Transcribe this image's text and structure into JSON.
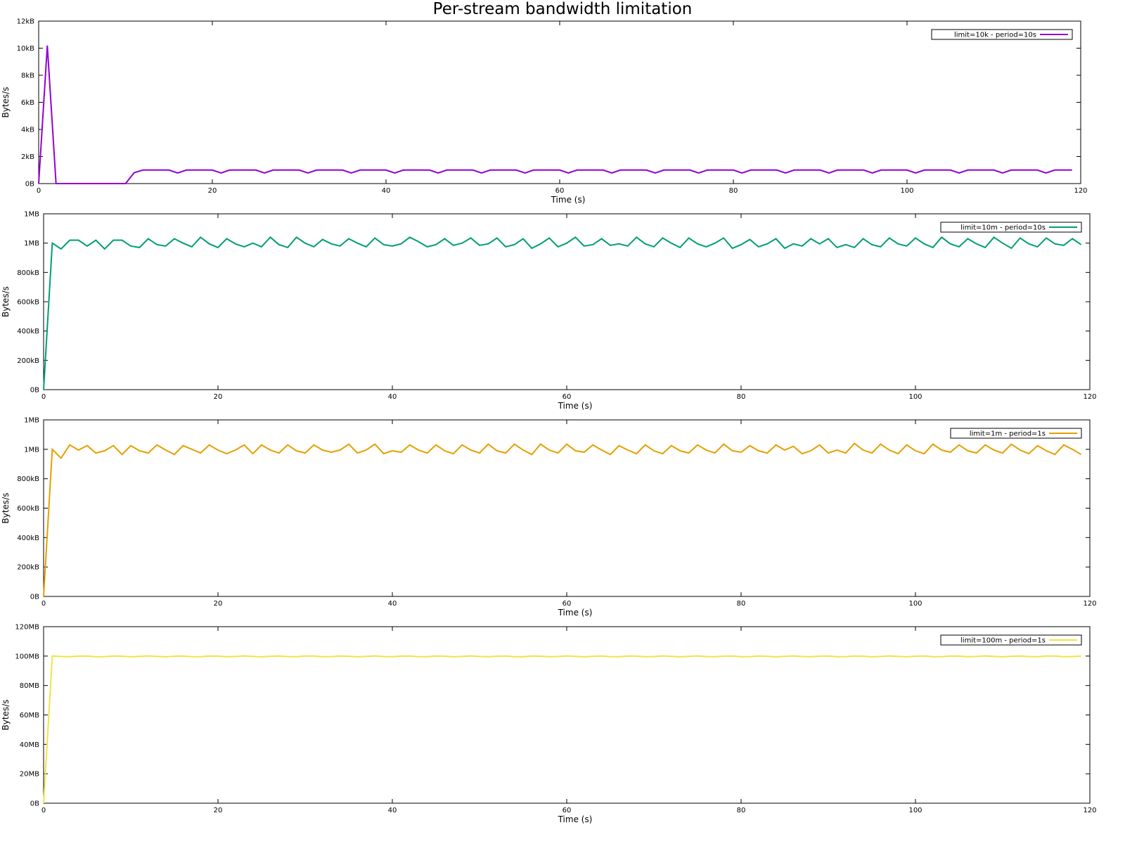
{
  "figure": {
    "title": "Per-stream bandwidth limitation"
  },
  "chart_data": [
    {
      "type": "line",
      "title": "",
      "xlabel": "Time (s)",
      "ylabel": "Bytes/s",
      "xlim": [
        0,
        120
      ],
      "ylim": [
        0,
        12000
      ],
      "grid": false,
      "legend_position": "top-right",
      "x_ticks": [
        0,
        20,
        40,
        60,
        80,
        100,
        120
      ],
      "x_tick_labels": [
        "0",
        "20",
        "40",
        "60",
        "80",
        "100",
        "120"
      ],
      "y_ticks": [
        0,
        2000,
        4000,
        6000,
        8000,
        10000,
        12000
      ],
      "y_tick_labels": [
        "0B",
        "2kB",
        "4kB",
        "6kB",
        "8kB",
        "10kB",
        "12kB"
      ],
      "series": [
        {
          "name": "limit=10k - period=10s",
          "color": "#9400d3",
          "pattern": {
            "peaks": [
              1000,
              1000
            ],
            "troughs": [
              780,
              780
            ],
            "cycle": 5,
            "start": 11
          },
          "x": [
            0,
            1,
            2,
            10,
            11
          ],
          "y": [
            0,
            10200,
            0,
            0,
            800
          ]
        }
      ]
    },
    {
      "type": "line",
      "title": "",
      "xlabel": "Time (s)",
      "ylabel": "Bytes/s",
      "xlim": [
        0,
        120
      ],
      "ylim": [
        0,
        1200000
      ],
      "grid": false,
      "legend_position": "top-right",
      "x_ticks": [
        0,
        20,
        40,
        60,
        80,
        100,
        120
      ],
      "x_tick_labels": [
        "0",
        "20",
        "40",
        "60",
        "80",
        "100",
        "120"
      ],
      "y_ticks": [
        0,
        200000,
        400000,
        600000,
        800000,
        1000000,
        1200000
      ],
      "y_tick_labels": [
        "0B",
        "200kB",
        "400kB",
        "600kB",
        "800kB",
        "1MB",
        "1MB"
      ],
      "series": [
        {
          "name": "limit=10m - period=10s",
          "color": "#009e73",
          "x": [
            0,
            1,
            2,
            3,
            4,
            5,
            6,
            7,
            8,
            9,
            10,
            11,
            12,
            13,
            14,
            15,
            16,
            17,
            18,
            19,
            20,
            21,
            22,
            23,
            24,
            25,
            26,
            27,
            28,
            29,
            30,
            31,
            32,
            33,
            34,
            35,
            36,
            37,
            38,
            39,
            40,
            41,
            42,
            43,
            44,
            45,
            46,
            47,
            48,
            49,
            50,
            51,
            52,
            53,
            54,
            55,
            56,
            57,
            58,
            59,
            60,
            61,
            62,
            63,
            64,
            65,
            66,
            67,
            68,
            69,
            70,
            71,
            72,
            73,
            74,
            75,
            76,
            77,
            78,
            79,
            80,
            81,
            82,
            83,
            84,
            85,
            86,
            87,
            88,
            89,
            90,
            91,
            92,
            93,
            94,
            95,
            96,
            97,
            98,
            99,
            100,
            101,
            102,
            103,
            104,
            105,
            106,
            107,
            108,
            109,
            110,
            111,
            112,
            113,
            114,
            115,
            116,
            117,
            118,
            119
          ],
          "y": [
            0,
            1000000,
            960000,
            1020000,
            1020000,
            980000,
            1020000,
            960000,
            1020000,
            1020000,
            980000,
            970000,
            1030000,
            990000,
            980000,
            1030000,
            1000000,
            975000,
            1040000,
            995000,
            970000,
            1030000,
            995000,
            975000,
            1000000,
            975000,
            1040000,
            990000,
            970000,
            1040000,
            1000000,
            975000,
            1025000,
            995000,
            980000,
            1030000,
            1000000,
            975000,
            1035000,
            990000,
            980000,
            995000,
            1040000,
            1010000,
            975000,
            990000,
            1030000,
            985000,
            1000000,
            1035000,
            985000,
            995000,
            1035000,
            975000,
            990000,
            1030000,
            965000,
            995000,
            1035000,
            975000,
            1000000,
            1040000,
            980000,
            990000,
            1030000,
            985000,
            995000,
            980000,
            1040000,
            995000,
            975000,
            1035000,
            1000000,
            970000,
            1035000,
            995000,
            975000,
            1000000,
            1035000,
            965000,
            990000,
            1025000,
            975000,
            995000,
            1030000,
            965000,
            995000,
            980000,
            1030000,
            995000,
            1030000,
            970000,
            990000,
            970000,
            1030000,
            990000,
            975000,
            1035000,
            995000,
            980000,
            1035000,
            995000,
            970000,
            1040000,
            995000,
            975000,
            1030000,
            995000,
            970000,
            1040000,
            1000000,
            965000,
            1035000,
            995000,
            975000,
            1035000,
            995000,
            985000,
            1030000,
            990000
          ]
        }
      ]
    },
    {
      "type": "line",
      "title": "",
      "xlabel": "Time (s)",
      "ylabel": "Bytes/s",
      "xlim": [
        0,
        120
      ],
      "ylim": [
        0,
        1200000
      ],
      "grid": false,
      "legend_position": "top-right",
      "x_ticks": [
        0,
        20,
        40,
        60,
        80,
        100,
        120
      ],
      "x_tick_labels": [
        "0",
        "20",
        "40",
        "60",
        "80",
        "100",
        "120"
      ],
      "y_ticks": [
        0,
        200000,
        400000,
        600000,
        800000,
        1000000,
        1200000
      ],
      "y_tick_labels": [
        "0B",
        "200kB",
        "400kB",
        "600kB",
        "800kB",
        "1MB",
        "1MB"
      ],
      "series": [
        {
          "name": "limit=1m - period=1s",
          "color": "#e69f00",
          "x": [
            0,
            1,
            2,
            3,
            4,
            5,
            6,
            7,
            8,
            9,
            10,
            11,
            12,
            13,
            14,
            15,
            16,
            17,
            18,
            19,
            20,
            21,
            22,
            23,
            24,
            25,
            26,
            27,
            28,
            29,
            30,
            31,
            32,
            33,
            34,
            35,
            36,
            37,
            38,
            39,
            40,
            41,
            42,
            43,
            44,
            45,
            46,
            47,
            48,
            49,
            50,
            51,
            52,
            53,
            54,
            55,
            56,
            57,
            58,
            59,
            60,
            61,
            62,
            63,
            64,
            65,
            66,
            67,
            68,
            69,
            70,
            71,
            72,
            73,
            74,
            75,
            76,
            77,
            78,
            79,
            80,
            81,
            82,
            83,
            84,
            85,
            86,
            87,
            88,
            89,
            90,
            91,
            92,
            93,
            94,
            95,
            96,
            97,
            98,
            99,
            100,
            101,
            102,
            103,
            104,
            105,
            106,
            107,
            108,
            109,
            110,
            111,
            112,
            113,
            114,
            115,
            116,
            117,
            118,
            119
          ],
          "y": [
            0,
            1000000,
            940000,
            1030000,
            995000,
            1025000,
            975000,
            990000,
            1025000,
            965000,
            1025000,
            990000,
            975000,
            1030000,
            995000,
            965000,
            1025000,
            1000000,
            975000,
            1030000,
            995000,
            970000,
            995000,
            1030000,
            970000,
            1030000,
            995000,
            975000,
            1030000,
            990000,
            975000,
            1030000,
            995000,
            980000,
            995000,
            1035000,
            975000,
            995000,
            1035000,
            970000,
            990000,
            980000,
            1030000,
            995000,
            975000,
            1030000,
            990000,
            970000,
            1030000,
            995000,
            975000,
            1035000,
            990000,
            975000,
            1035000,
            995000,
            965000,
            1035000,
            995000,
            975000,
            1035000,
            990000,
            980000,
            1030000,
            995000,
            965000,
            1025000,
            995000,
            970000,
            1030000,
            990000,
            970000,
            1025000,
            990000,
            975000,
            1030000,
            995000,
            975000,
            1035000,
            990000,
            980000,
            1025000,
            990000,
            975000,
            1030000,
            995000,
            1020000,
            970000,
            990000,
            1030000,
            975000,
            995000,
            975000,
            1040000,
            995000,
            975000,
            1035000,
            995000,
            970000,
            1030000,
            990000,
            970000,
            1035000,
            995000,
            980000,
            1030000,
            990000,
            975000,
            1030000,
            995000,
            975000,
            1035000,
            995000,
            970000,
            1025000,
            990000,
            965000,
            1030000,
            1000000,
            965000
          ]
        }
      ]
    },
    {
      "type": "line",
      "title": "",
      "xlabel": "Time (s)",
      "ylabel": "Bytes/s",
      "xlim": [
        0,
        120
      ],
      "ylim": [
        0,
        120000000
      ],
      "grid": false,
      "legend_position": "top-right",
      "x_ticks": [
        0,
        20,
        40,
        60,
        80,
        100,
        120
      ],
      "x_tick_labels": [
        "0",
        "20",
        "40",
        "60",
        "80",
        "100",
        "120"
      ],
      "y_ticks": [
        0,
        20000000,
        40000000,
        60000000,
        80000000,
        100000000,
        120000000
      ],
      "y_tick_labels": [
        "0B",
        "20MB",
        "40MB",
        "60MB",
        "80MB",
        "100MB",
        "120MB"
      ],
      "series": [
        {
          "name": "limit=100m - period=1s",
          "color": "#f0e442",
          "steady": {
            "from": 1,
            "value": 99800000,
            "jitter": 300000
          },
          "x": [
            0,
            1
          ],
          "y": [
            0,
            100000000
          ]
        }
      ]
    }
  ]
}
